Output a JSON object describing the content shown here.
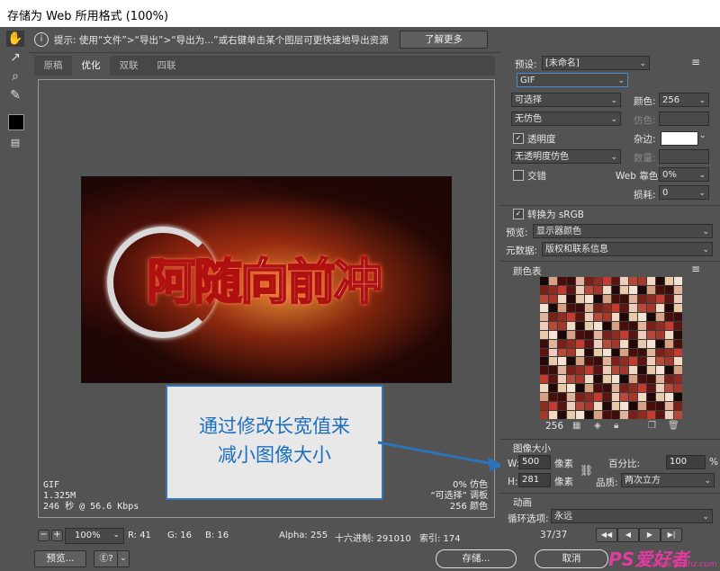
{
  "window": {
    "title": "存储为 Web 所用格式 (100%)"
  },
  "info": {
    "text": "提示: 使用“文件”>“导出”>“导出为...”或右键单击某个图层可更快速地导出资源",
    "button": "了解更多"
  },
  "tabs": [
    "原稿",
    "优化",
    "双联",
    "四联"
  ],
  "preview": {
    "text": "阿随向前冲",
    "callout_line1": "通过修改长宽值来",
    "callout_line2": "减小图像大小"
  },
  "status_left": {
    "format": "GIF",
    "size": "1.325M",
    "time": "246 秒 @ 56.6 Kbps"
  },
  "status_right": {
    "dither": "0% 仿色",
    "palette": "“可选择” 调板",
    "colors": "256 颜色"
  },
  "bottombar": {
    "zoom": "100%",
    "r": "R: 41",
    "g": "G: 16",
    "b": "B: 16",
    "alpha": "Alpha: 255",
    "hex": "十六进制: 291010",
    "index": "索引: 174"
  },
  "footer": {
    "preview_button": "预览...",
    "save_button": "存储...",
    "cancel_button": "取消"
  },
  "settings": {
    "preset_label": "预设:",
    "preset_value": "[未命名]",
    "format": "GIF",
    "reduction": "可选择",
    "colors_label": "颜色:",
    "colors_value": "256",
    "dither_algo": "无仿色",
    "dither_label": "仿色:",
    "transparency_label": "透明度",
    "matte_label": "杂边:",
    "trans_dither": "无透明度仿色",
    "amount_label": "数量:",
    "interlaced_label": "交错",
    "websnap_label": "Web 靠色:",
    "websnap_value": "0%",
    "lossy_label": "损耗:",
    "lossy_value": "0",
    "srgb_label": "转换为 sRGB",
    "preview_label": "预览:",
    "preview_value": "显示器颜色",
    "metadata_label": "元数据:",
    "metadata_value": "版权和联系信息"
  },
  "color_table": {
    "title": "颜色表",
    "count": "256",
    "colors": [
      "#1a0707",
      "#c63b2f",
      "#e8c9a8",
      "#7a2018",
      "#f2d9c4",
      "#3b0c09",
      "#b5493a",
      "#d8a183",
      "#5c1410",
      "#f5e3d6",
      "#8e2c22",
      "#240808",
      "#e2b39a",
      "#a8372b",
      "#4a0f0b",
      "#f0ccbb"
    ]
  },
  "image_size": {
    "title": "图像大小",
    "w_label": "W:",
    "w_value": "500",
    "h_label": "H:",
    "h_value": "281",
    "unit": "像素",
    "percent_label": "百分比:",
    "percent_value": "100",
    "percent_unit": "%",
    "quality_label": "品质:",
    "quality_value": "两次立方"
  },
  "animation": {
    "title": "动画",
    "loop_label": "循环选项:",
    "loop_value": "永远",
    "frame": "37/37"
  },
  "watermark": {
    "text": "PS爱好者",
    "url": "www.psahz.com"
  }
}
